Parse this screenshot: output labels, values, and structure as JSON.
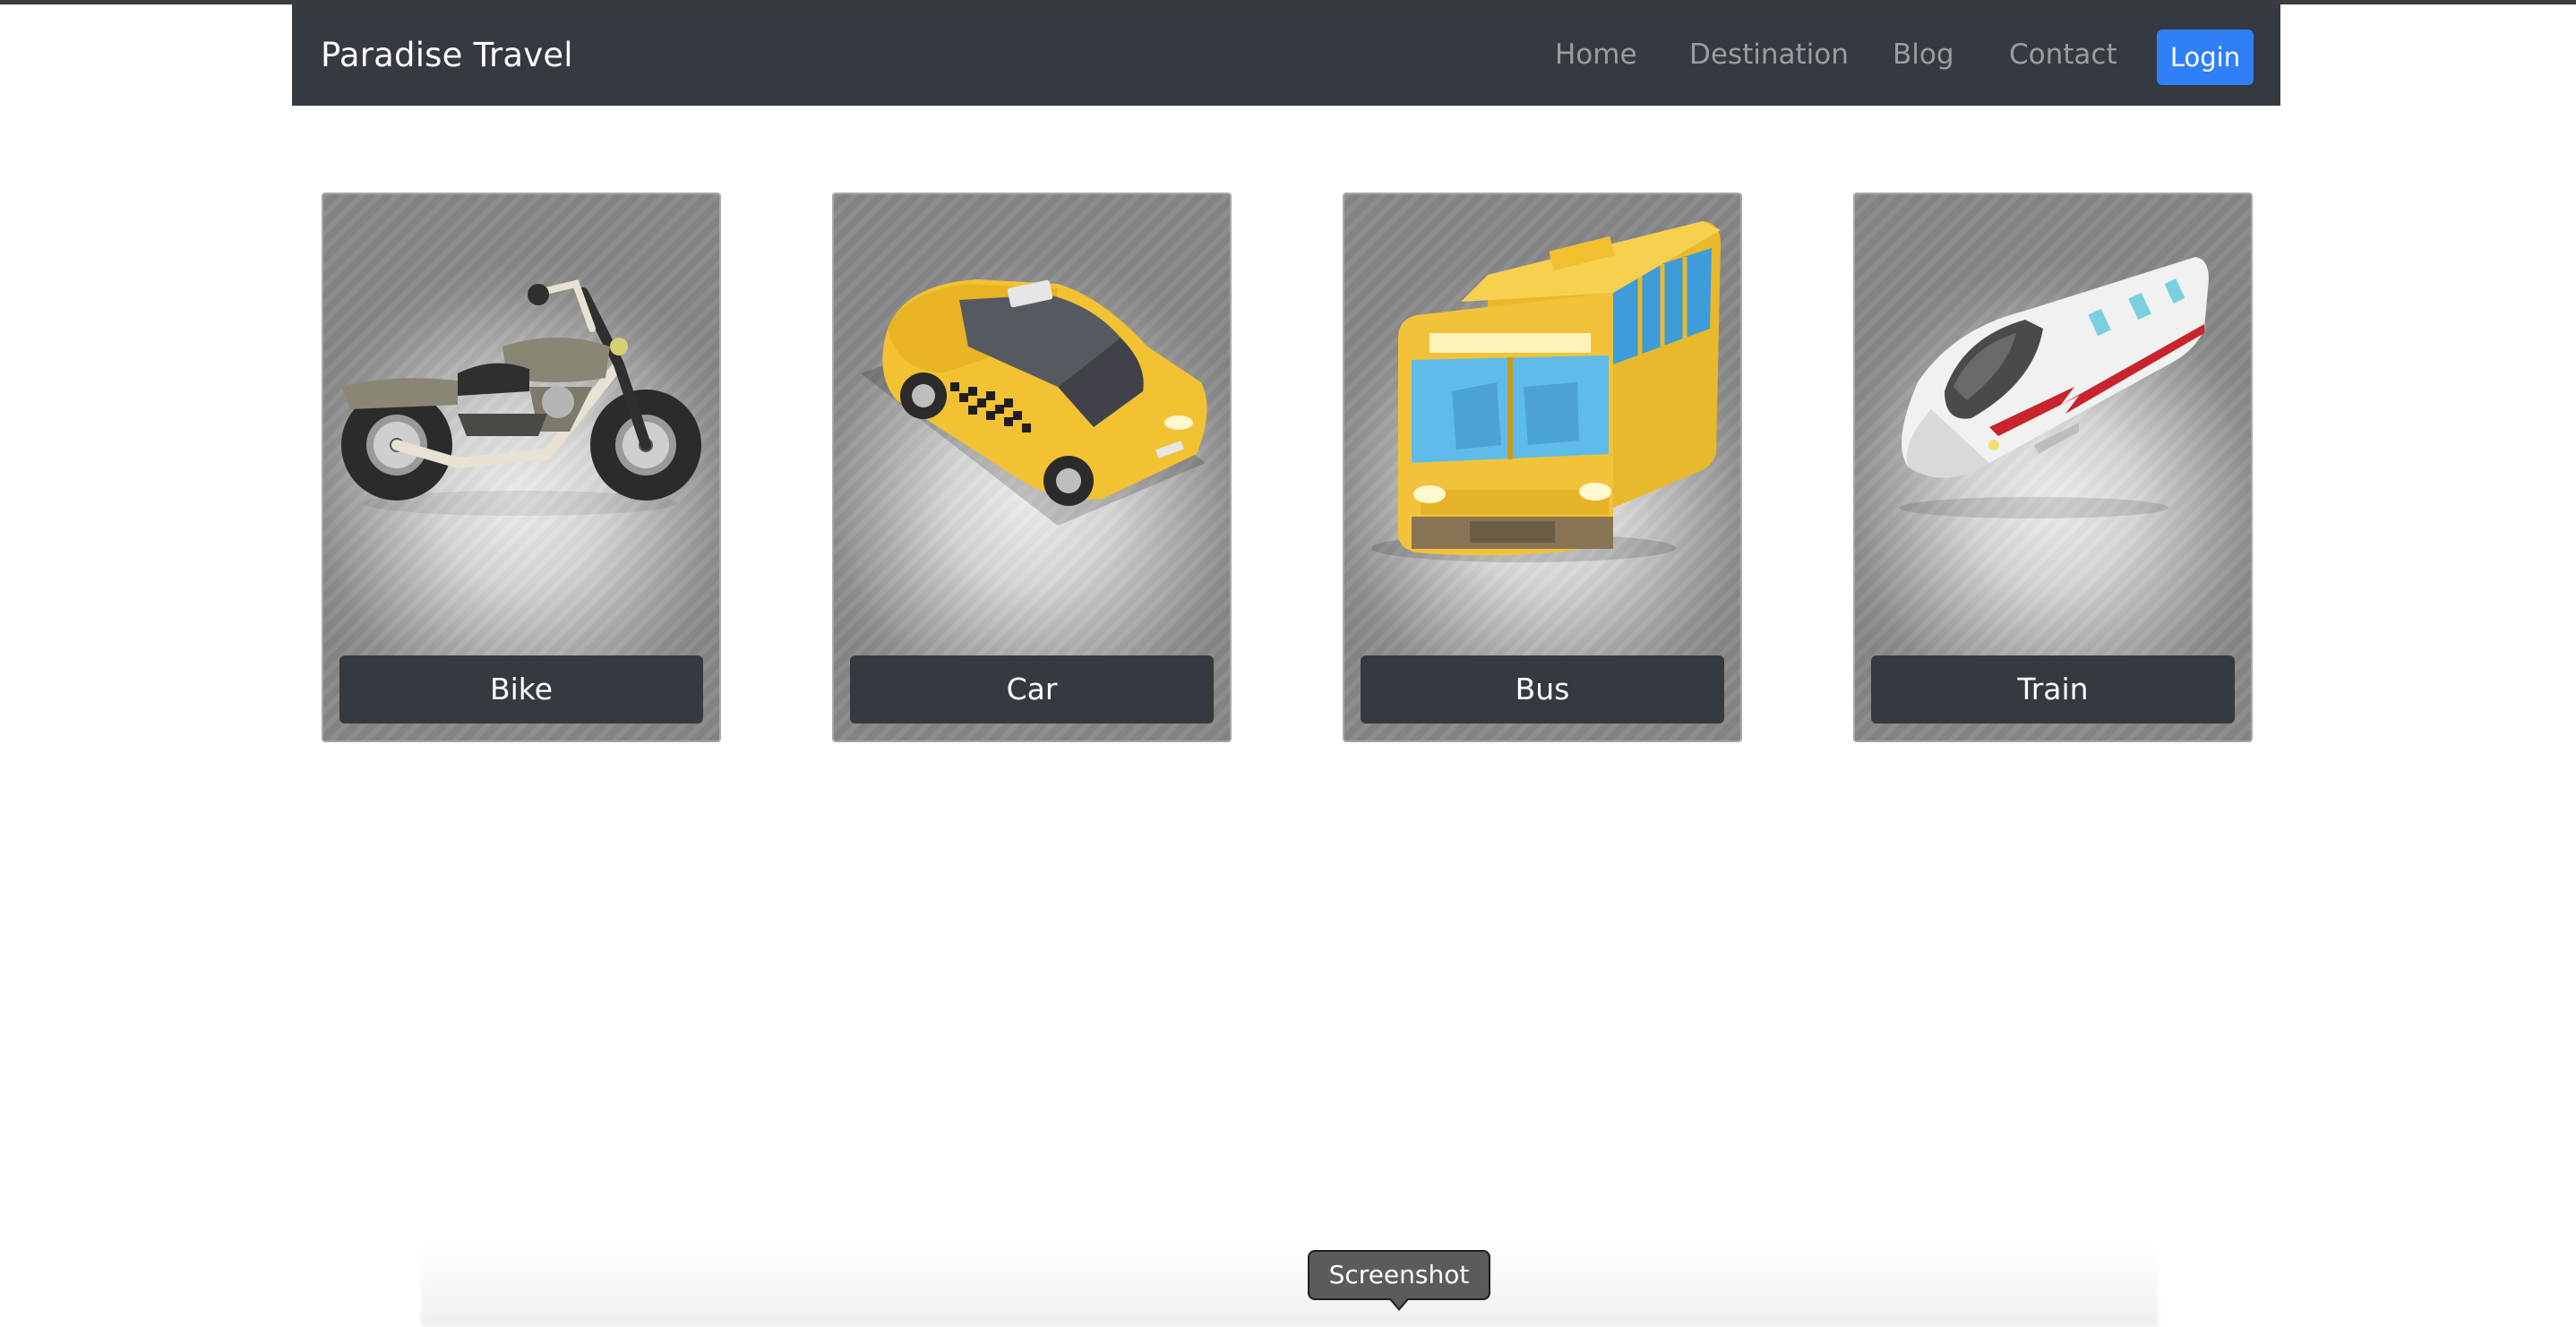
{
  "navbar": {
    "brand": "Paradise Travel",
    "links": [
      {
        "label": "Home"
      },
      {
        "label": "Destination"
      },
      {
        "label": "Blog"
      },
      {
        "label": "Contact"
      }
    ],
    "login_label": "Login"
  },
  "cards": [
    {
      "label": "Bike",
      "icon": "motorcycle-icon"
    },
    {
      "label": "Car",
      "icon": "taxi-car-icon"
    },
    {
      "label": "Bus",
      "icon": "bus-icon"
    },
    {
      "label": "Train",
      "icon": "bullet-train-icon"
    }
  ],
  "tooltip": {
    "label": "Screenshot"
  },
  "colors": {
    "navbar_bg": "#343a40",
    "login_bg": "#2f7ff7",
    "card_button_bg": "#343a40",
    "nav_link": "rgba(255,255,255,0.5)"
  }
}
